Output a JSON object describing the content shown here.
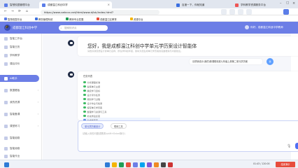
{
  "browser": {
    "tabs": [
      {
        "label": "智慧校园管理平台",
        "active": false,
        "color": "#5b7de8"
      },
      {
        "label": "成都温江科创中学",
        "active": true,
        "color": "#5b7de8"
      },
      {
        "label": "百度一下，你就知道",
        "active": false,
        "color": "#3b6fe0"
      },
      {
        "label": "学科教学资源服务平台",
        "active": false,
        "color": "#e55"
      }
    ],
    "url": "https://www.cwkcxx.net/html/www.d/isk/index.html?",
    "bookmarks": [
      "智慧校园平台",
      "教务管理系统",
      "教师专业发展",
      "成都温江区教育",
      "资源平台"
    ]
  },
  "app": {
    "name": "成都温江科创中学",
    "search_placeholder": "搜索知识点",
    "user": "你好，成都温江科创中学教师"
  },
  "sidebar": {
    "items": [
      {
        "label": "智能工作台",
        "icon": "home-icon",
        "arrow": ""
      },
      {
        "label": "智能日历",
        "icon": "calendar-icon",
        "arrow": ""
      },
      {
        "label": "学科教学",
        "icon": "book-icon",
        "arrow": ""
      },
      {
        "label": "课后评价",
        "icon": "chart-icon",
        "arrow": ""
      },
      {
        "label": "AI助手",
        "icon": "robot-icon",
        "arrow": "",
        "active": true
      },
      {
        "label": "数据看板",
        "icon": "grid-icon",
        "arrow": "›"
      },
      {
        "label": "我的资源",
        "icon": "folder-icon",
        "arrow": "›"
      },
      {
        "label": "智能备课",
        "icon": "pen-icon",
        "arrow": "›"
      },
      {
        "label": "课堂练习",
        "icon": "clipboard-icon",
        "arrow": "›"
      },
      {
        "label": "智能组卷",
        "icon": "doc-icon",
        "arrow": ""
      },
      {
        "label": "智能阅卷",
        "icon": "check-icon",
        "arrow": ""
      },
      {
        "label": "智能作业",
        "icon": "task-icon",
        "arrow": ""
      }
    ]
  },
  "chat": {
    "greeting_title": "您好，我是成都温江科创中学单元学历案设计智能体",
    "greeting_sub": "请告诉我您想设计的单元名称、所在学科和年级，我将为您生成单元学历案的完整框架与内容建议。",
    "user_message": "请帮我设计(我的)新课程标准七年级上册第二单元学历案",
    "response_header": "任务列表",
    "tasks": [
      {
        "label": "分析课程标准",
        "done": true
      },
      {
        "label": "提炼单元主题",
        "done": true
      },
      {
        "label": "确定学习目标",
        "done": true
      },
      {
        "label": "设计评价任务",
        "done": true
      },
      {
        "label": "规划学习过程",
        "done": true
      },
      {
        "label": "设计作业与检测",
        "done": true
      },
      {
        "label": "编写单元学历案",
        "done": true
      },
      {
        "label": "整理学习资源与工具",
        "done": true
      },
      {
        "label": "补充学后反思",
        "done": true
      },
      {
        "label": "生成学历案",
        "done": false
      }
    ]
  },
  "composer": {
    "mode_chip": "单元学历案设计",
    "tool_chip": "联网工具",
    "placeholder": "请输入你的问题或需求(shift+Enter换行)",
    "send_label": "➤"
  },
  "taskbar": {
    "time": "01:43 / 120:00",
    "badge": "结束演示",
    "apps": [
      "#2e7bd6",
      "#f4b400",
      "#1f9d55",
      "#e94e3c",
      "#6c7ee6",
      "#00a4ef",
      "#7f56d9",
      "#f08a24",
      "#444",
      "#c33"
    ]
  }
}
